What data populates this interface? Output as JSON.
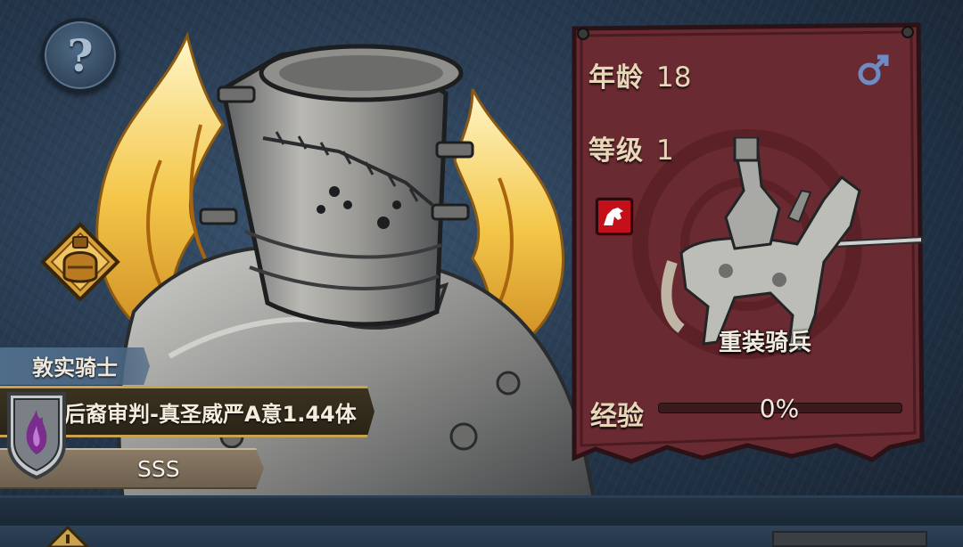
{
  "stats": {
    "age_label": "年龄",
    "age_value": "18",
    "level_label": "等级",
    "level_value": "1",
    "exp_label": "经验",
    "exp_value": "0%",
    "exp_fraction": 0
  },
  "unit": {
    "class_name": "重装骑兵"
  },
  "hero": {
    "trait_title": "敦实骑士",
    "skill_text": "后裔审判-真圣威严A意1.44体",
    "rank": "SSS"
  },
  "icons": {
    "help": "?",
    "gender": "male-icon",
    "class_badge": "cavalry-icon",
    "item": "potion-icon",
    "shield": "flame-shield-icon",
    "warning": "warning-icon"
  },
  "colors": {
    "panel": "#6a2a31",
    "gold": "#c9a24e",
    "text": "#e7d7b8",
    "badge": "#c4101a"
  }
}
